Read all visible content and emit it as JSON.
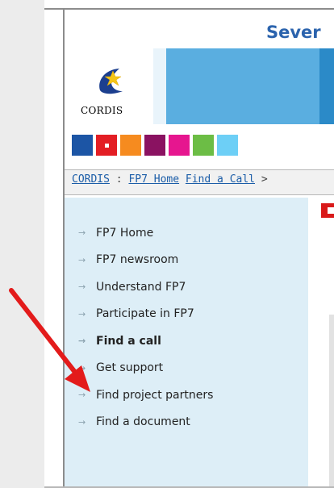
{
  "header": {
    "title": "Sever"
  },
  "logo": {
    "text": "CORDIS"
  },
  "colors": {
    "swatches": [
      "#1c55a5",
      "#e31e24",
      "#f68b1f",
      "#8a1261",
      "#e6168f",
      "#6cbd45",
      "#6dcff6"
    ],
    "annotation": "#e31b1b"
  },
  "breadcrumb": {
    "link1": "CORDIS",
    "sep": " : ",
    "link2": "FP7 Home",
    "link3": "Find a Call",
    "more": " >"
  },
  "sidebar": {
    "items": [
      {
        "label": "FP7 Home"
      },
      {
        "label": "FP7 newsroom"
      },
      {
        "label": "Understand FP7"
      },
      {
        "label": "Participate in FP7"
      },
      {
        "label": "Find a call"
      },
      {
        "label": "Get support"
      },
      {
        "label": "Find project partners"
      },
      {
        "label": "Find a document"
      }
    ]
  }
}
